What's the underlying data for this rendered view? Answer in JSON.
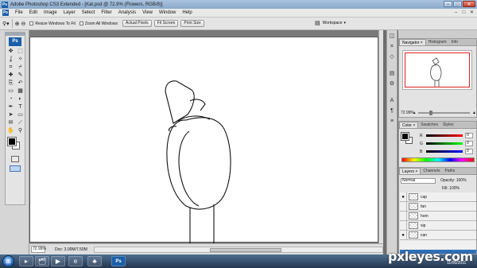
{
  "window": {
    "title": "Adobe Photoshop CS3 Extended - [Kat.psd @ 72.9% (Flowers, RGB/8)]",
    "buttons": [
      "–",
      "□",
      "✕"
    ]
  },
  "menu": {
    "items": [
      "File",
      "Edit",
      "Image",
      "Layer",
      "Select",
      "Filter",
      "Analysis",
      "View",
      "Window",
      "Help"
    ],
    "doc_buttons": [
      "–",
      "□",
      "✕"
    ]
  },
  "options": {
    "resize_windows": "Resize Windows To Fit",
    "zoom_all_windows": "Zoom All Windows",
    "actual_pixels": "Actual Pixels",
    "fit_screen": "Fit Screen",
    "print_size": "Print Size",
    "workspace": "Workspace"
  },
  "tools": {
    "icons": [
      "move-icon",
      "marquee-icon",
      "lasso-icon",
      "magic-wand-icon",
      "crop-icon",
      "slice-icon",
      "healing-brush-icon",
      "brush-icon",
      "clone-stamp-icon",
      "history-brush-icon",
      "eraser-icon",
      "gradient-icon",
      "blur-icon",
      "dodge-icon",
      "pen-icon",
      "type-icon",
      "path-select-icon",
      "shape-icon",
      "notes-icon",
      "eyedropper-icon",
      "hand-icon",
      "zoom-icon"
    ],
    "glyphs": [
      "✥",
      "⬚",
      "ʆ",
      "✧",
      "⌗",
      "⌿",
      "✚",
      "✎",
      "⎘",
      "↶",
      "▭",
      "▦",
      "◔",
      "◐",
      "✒",
      "T",
      "➤",
      "▭",
      "✉",
      "⟋",
      "✋",
      "⚲"
    ],
    "foreground_color": "#000000",
    "background_color": "#ffffff"
  },
  "status": {
    "zoom": "72.99%",
    "doc_size": "Doc: 3.00M/7.50M"
  },
  "dock": {
    "glyphs": [
      "◫",
      "⌗",
      "◇",
      "▤",
      "⚙",
      "A",
      "¶",
      "≡"
    ]
  },
  "navigator": {
    "tabs": [
      "Navigator ×",
      "Histogram",
      "Info"
    ],
    "zoom": "72.99%"
  },
  "color_panel": {
    "tabs": [
      "Color ×",
      "Swatches",
      "Styles"
    ],
    "channels": [
      {
        "label": "R",
        "value": "0",
        "bar": "linear-gradient(90deg,#000,#f00)"
      },
      {
        "label": "G",
        "value": "0",
        "bar": "linear-gradient(90deg,#000,#0f0)"
      },
      {
        "label": "B",
        "value": "0",
        "bar": "linear-gradient(90deg,#000,#00f)"
      }
    ]
  },
  "layers_panel": {
    "tabs": [
      "Layers ×",
      "Channels",
      "Paths"
    ],
    "blend_mode": "Normal",
    "opacity": "Opacity: 100%",
    "fill": "Fill: 100%",
    "layers": [
      {
        "name": "cap",
        "visible": true,
        "selected": false
      },
      {
        "name": "fan",
        "visible": false,
        "selected": false
      },
      {
        "name": "hom",
        "visible": false,
        "selected": false
      },
      {
        "name": "sip",
        "visible": false,
        "selected": false
      },
      {
        "name": "can",
        "visible": true,
        "selected": false
      }
    ]
  },
  "taskbar": {
    "start": "⊞",
    "apps": [
      "▸",
      "🗂",
      "▶",
      "e",
      "♣",
      "Ps"
    ]
  },
  "watermark": "pxleyes.com",
  "date": "11/06/2011"
}
